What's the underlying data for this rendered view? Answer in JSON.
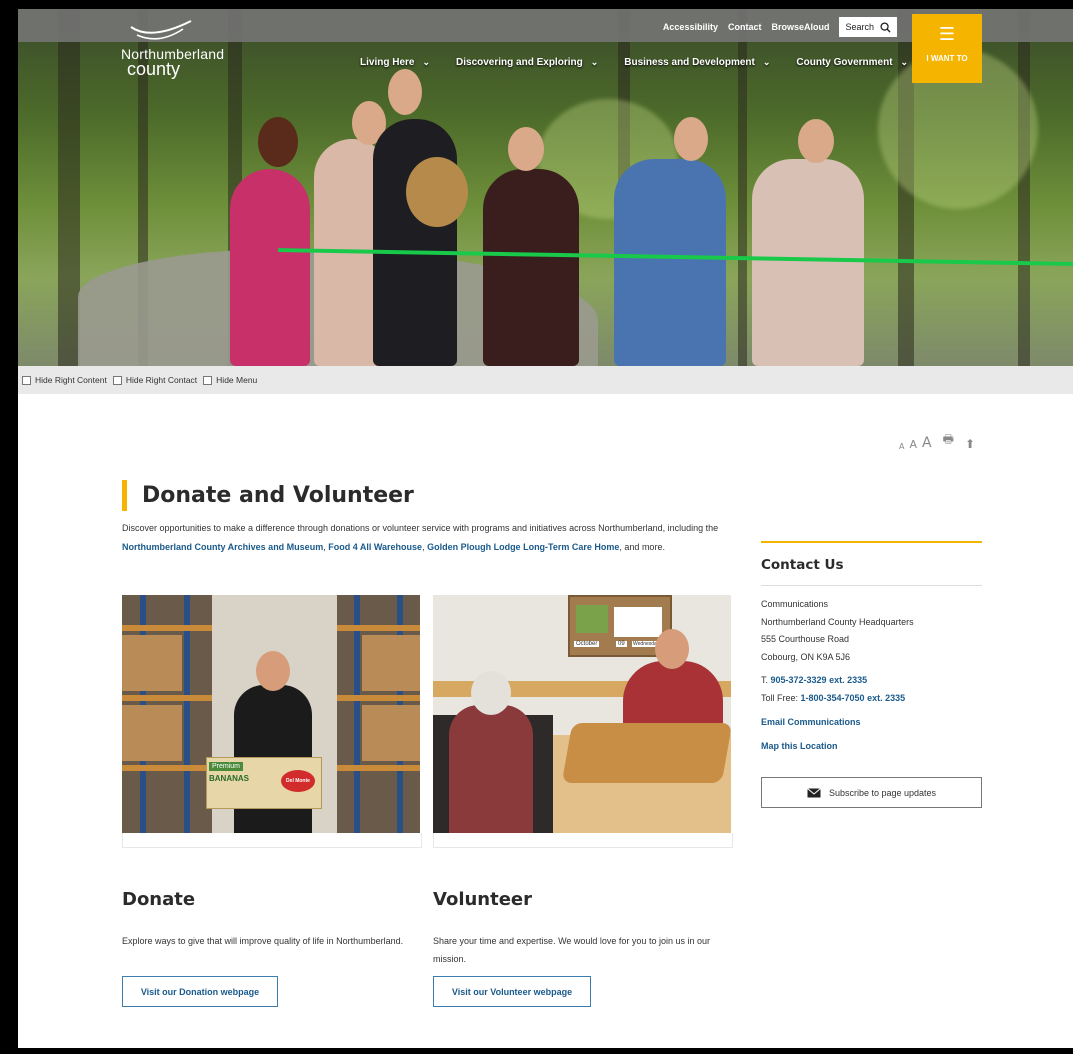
{
  "header": {
    "logo_line1": "Northumberland",
    "logo_line2": "county",
    "utility_links": [
      "Accessibility",
      "Contact",
      "BrowseAloud"
    ],
    "search_label": "Search",
    "nav": [
      "Living Here",
      "Discovering and Exploring",
      "Business and Development",
      "County Government"
    ],
    "iwant_label": "I WANT TO"
  },
  "toggles": [
    "Hide Right Content",
    "Hide Right Contact",
    "Hide Menu"
  ],
  "tools": {
    "font_small": "A",
    "font_medium": "A",
    "font_large": "A"
  },
  "page": {
    "title": "Donate and Volunteer",
    "intro_before": "Discover opportunities to make a difference through donations or volunteer service with programs and initiatives across Northumberland, including the ",
    "link_archives": "Northumberland County Archives and Museum",
    "sep1": ", ",
    "link_food": "Food 4 All Warehouse",
    "sep2": ", ",
    "link_lodge": "Golden Plough Lodge Long-Term Care Home",
    "intro_after": ", and more.",
    "box_label_1": "Premium",
    "box_label_2": "BANANAS",
    "box_brand": "Del Monte",
    "calendar_month": "October",
    "calendar_day": "09",
    "calendar_weekday": "Wednesday"
  },
  "donate": {
    "heading": "Donate",
    "text": "Explore ways to give that will improve quality of life in Northumberland.",
    "button": "Visit our Donation webpage"
  },
  "volunteer": {
    "heading": "Volunteer",
    "text": "Share your time and expertise. We would love for you to join us in our mission.",
    "button": "Visit our Volunteer webpage"
  },
  "contact": {
    "heading": "Contact Us",
    "dept": "Communications",
    "org": "Northumberland County Headquarters",
    "street": "555 Courthouse Road",
    "city": "Cobourg, ON K9A 5J6",
    "phone_prefix": "T. ",
    "phone": "905-372-3329 ext. 2335",
    "tollfree_prefix": "Toll Free: ",
    "tollfree": "1-800-354-7050 ext. 2335",
    "email_link": "Email Communications",
    "map_link": "Map this Location",
    "subscribe": "Subscribe to page updates"
  },
  "colors": {
    "accent": "#f5b400",
    "link": "#1a5a8c"
  }
}
